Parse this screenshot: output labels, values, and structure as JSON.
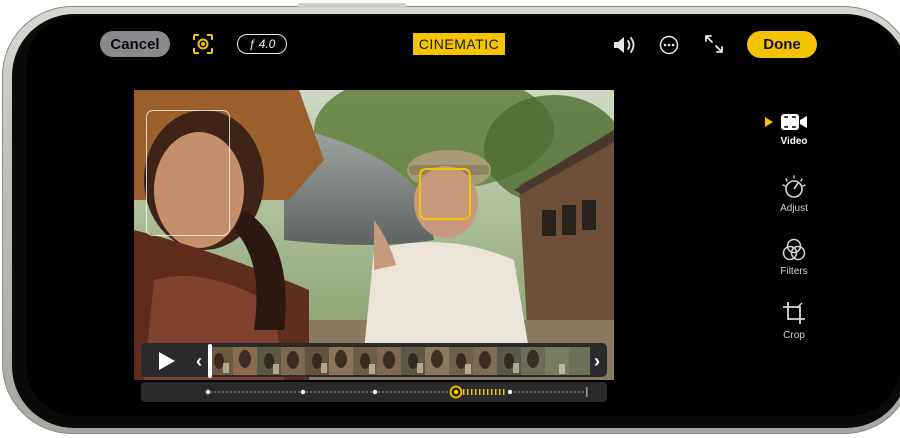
{
  "topbar": {
    "cancel_label": "Cancel",
    "fstop_label": "ƒ 4.0",
    "mode_label": "CINEMATIC",
    "done_label": "Done"
  },
  "sidebar": {
    "items": [
      {
        "label": "Video",
        "icon": "video-camera-icon",
        "active": true
      },
      {
        "label": "Adjust",
        "icon": "adjust-dial-icon",
        "active": false
      },
      {
        "label": "Filters",
        "icon": "filters-circles-icon",
        "active": false
      },
      {
        "label": "Crop",
        "icon": "crop-icon",
        "active": false
      }
    ]
  },
  "colors": {
    "accent": "#f5c400",
    "pill_gray": "#8a8a8e",
    "track": "#2a2a2c"
  },
  "icons": {
    "focus": "focus-lock-icon",
    "speaker": "speaker-icon",
    "more": "more-ellipsis-icon",
    "expand": "expand-arrows-icon",
    "play": "play-icon"
  }
}
